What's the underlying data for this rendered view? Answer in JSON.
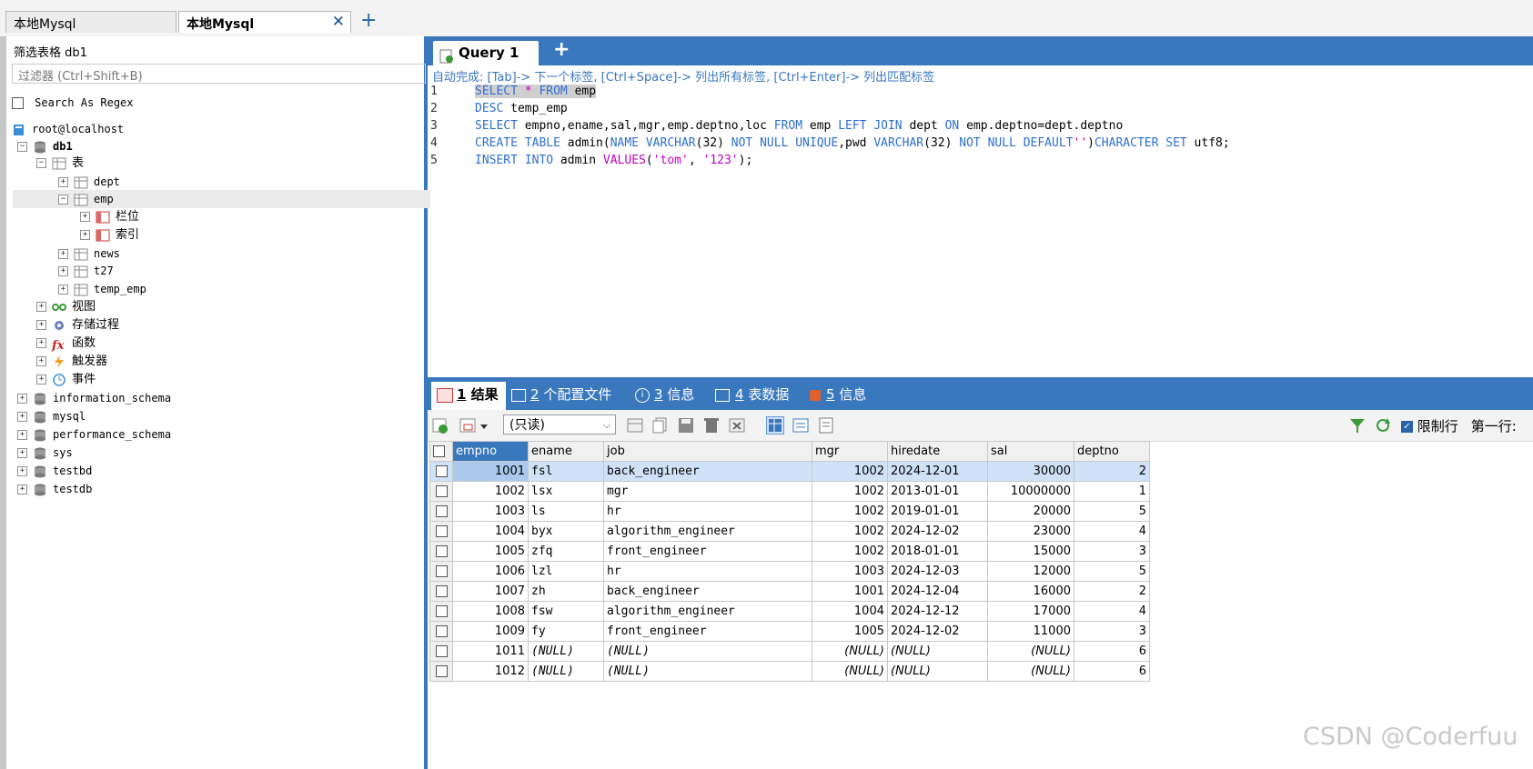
{
  "connection_tabs": [
    {
      "label": "本地Mysql"
    },
    {
      "label": "本地Mysql"
    }
  ],
  "filter": {
    "label": "筛选表格 db1",
    "placeholder": "过滤器 (Ctrl+Shift+B)",
    "regex_label": "Search As Regex"
  },
  "tree": {
    "root": "root@localhost",
    "db1": "db1",
    "tables_label": "表",
    "tables": [
      "dept",
      "emp",
      "news",
      "t27",
      "temp_emp"
    ],
    "emp_children": [
      "栏位",
      "索引"
    ],
    "folders": [
      "视图",
      "存储过程",
      "函数",
      "触发器",
      "事件"
    ],
    "other_dbs": [
      "information_schema",
      "mysql",
      "performance_schema",
      "sys",
      "testbd",
      "testdb"
    ]
  },
  "editor": {
    "tab_label": "Query 1",
    "hint": "自动完成: [Tab]-> 下一个标签, [Ctrl+Space]-> 列出所有标签, [Ctrl+Enter]-> 列出匹配标签",
    "line_numbers": [
      "1",
      "2",
      "3",
      "4",
      "5"
    ]
  },
  "result_tabs": [
    {
      "num": "1",
      "label": "结果"
    },
    {
      "num": "2",
      "label": "个配置文件"
    },
    {
      "num": "3",
      "label": "信息"
    },
    {
      "num": "4",
      "label": "表数据"
    },
    {
      "num": "5",
      "label": "信息"
    }
  ],
  "toolbar": {
    "mode": "(只读)",
    "limit_label": "限制行",
    "first_row_label": "第一行:"
  },
  "grid": {
    "columns": [
      "empno",
      "ename",
      "job",
      "mgr",
      "hiredate",
      "sal",
      "deptno"
    ],
    "rows": [
      [
        "1001",
        "fsl",
        "back_engineer",
        "1002",
        "2024-12-01",
        "30000",
        "2"
      ],
      [
        "1002",
        "lsx",
        "mgr",
        "1002",
        "2013-01-01",
        "10000000",
        "1"
      ],
      [
        "1003",
        "ls",
        "hr",
        "1002",
        "2019-01-01",
        "20000",
        "5"
      ],
      [
        "1004",
        "byx",
        "algorithm_engineer",
        "1002",
        "2024-12-02",
        "23000",
        "4"
      ],
      [
        "1005",
        "zfq",
        "front_engineer",
        "1002",
        "2018-01-01",
        "15000",
        "3"
      ],
      [
        "1006",
        "lzl",
        "hr",
        "1003",
        "2024-12-03",
        "12000",
        "5"
      ],
      [
        "1007",
        "zh",
        "back_engineer",
        "1001",
        "2024-12-04",
        "16000",
        "2"
      ],
      [
        "1008",
        "fsw",
        "algorithm_engineer",
        "1004",
        "2024-12-12",
        "17000",
        "4"
      ],
      [
        "1009",
        "fy",
        "front_engineer",
        "1005",
        "2024-12-02",
        "11000",
        "3"
      ],
      [
        "1011",
        "(NULL)",
        "(NULL)",
        "(NULL)",
        "(NULL)",
        "(NULL)",
        "6"
      ],
      [
        "1012",
        "(NULL)",
        "(NULL)",
        "(NULL)",
        "(NULL)",
        "(NULL)",
        "6"
      ]
    ]
  },
  "watermark": "CSDN @Coderfuu"
}
